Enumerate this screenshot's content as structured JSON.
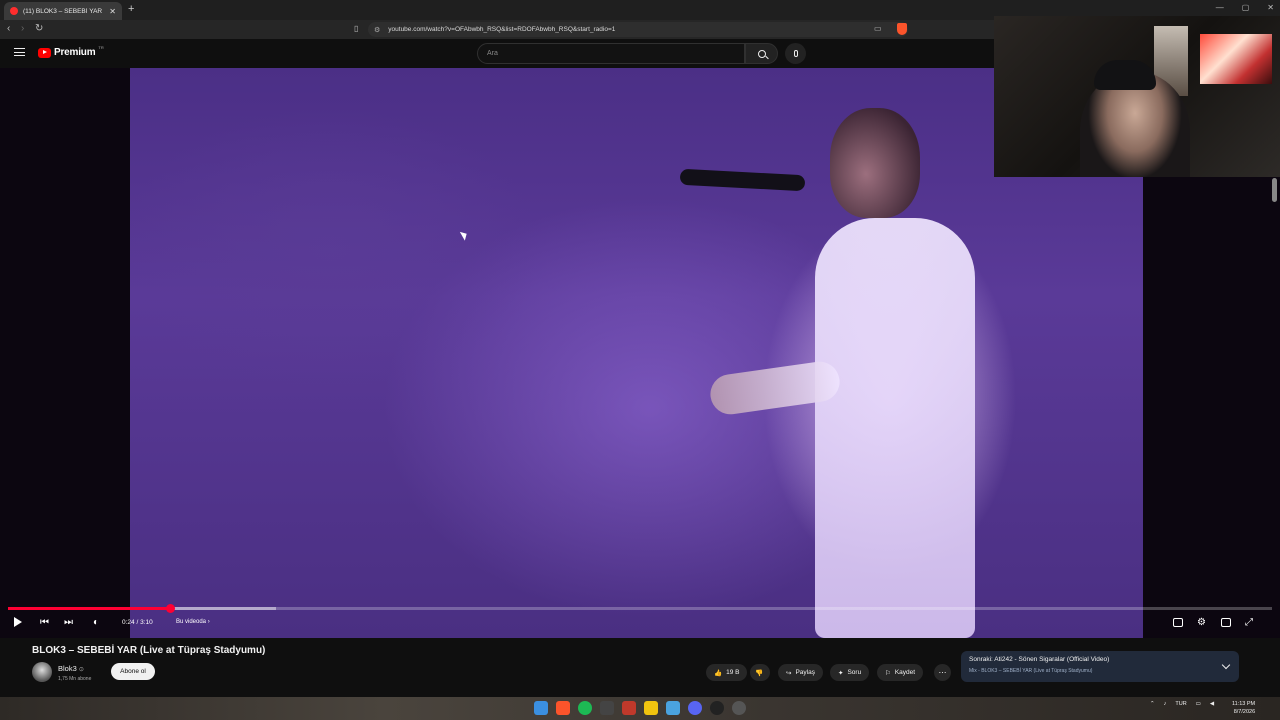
{
  "browser": {
    "tab_title": "(11) BLOK3 – SEBEBİ YAR (Live a",
    "url": "youtube.com/watch?v=OFAbwbh_RSQ&list=RDOFAbwbh_RSQ&start_radio=1"
  },
  "header": {
    "logo_text": "Premium",
    "logo_country": "TR",
    "search_placeholder": "Ara"
  },
  "player": {
    "time": "0:24 / 3:10",
    "chapter": "Bu videoda",
    "progress_played": 0.128,
    "progress_buffered": 0.212
  },
  "video": {
    "title": "BLOK3 – SEBEBİ YAR (Live at Tüpraş Stadyumu)",
    "channel": "Blok3",
    "subscribers": "1,75 Mn abone",
    "subscribe_label": "Abone ol",
    "likes": "19 B",
    "share_label": "Paylaş",
    "ask_label": "Soru",
    "save_label": "Kaydet"
  },
  "up_next": {
    "title": "Sonraki: Ati242 - Sönen Sigaralar (Official Video)",
    "subtitle": "Mix - BLOK3 – SEBEBİ YAR (Live at Tüpraş Stadyumu)"
  },
  "taskbar": {
    "lang": "TUR",
    "time": "11:13 PM",
    "date": "8/7/2026"
  },
  "colors": {
    "accent": "#ff0033",
    "youtube_red": "#ff0000",
    "background": "#0f0f0f"
  }
}
